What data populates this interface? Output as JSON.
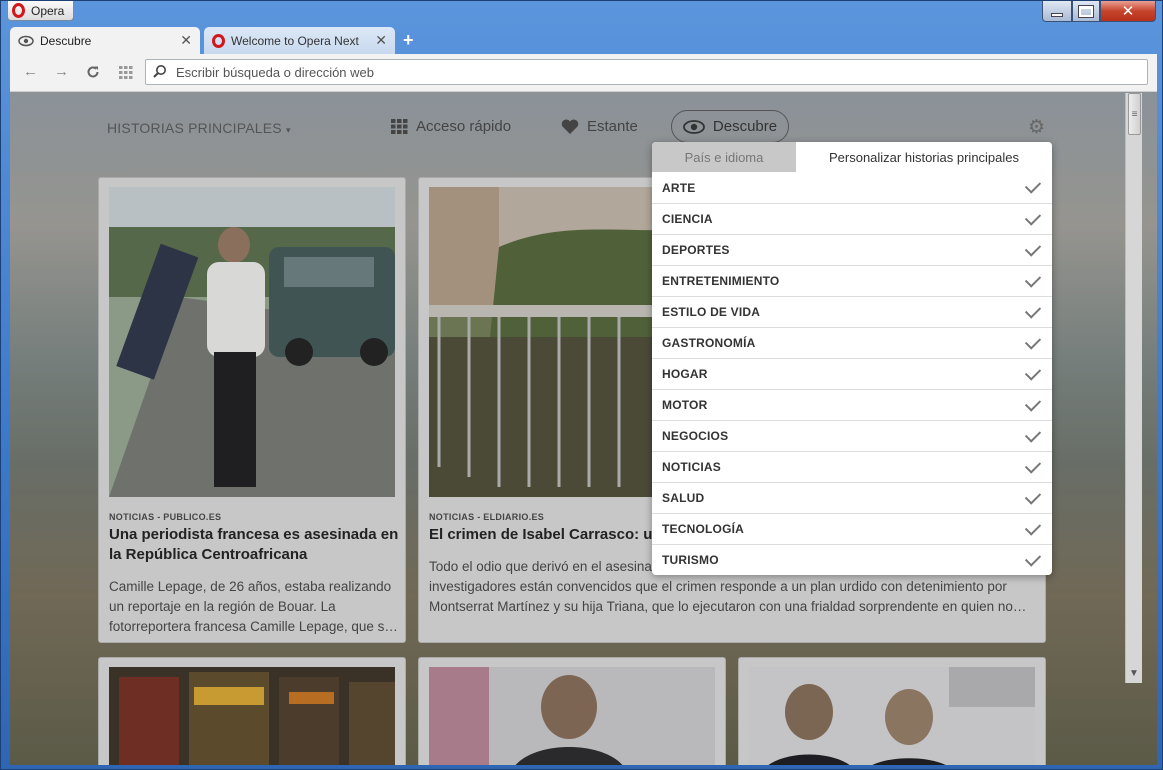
{
  "window": {
    "app_name": "Opera"
  },
  "tabs": [
    {
      "label": "Descubre",
      "active": true,
      "icon": "eye-icon"
    },
    {
      "label": "Welcome to Opera Next",
      "active": false,
      "icon": "opera-icon"
    }
  ],
  "address_bar": {
    "placeholder": "Escribir búsqueda o dirección web"
  },
  "topnav": {
    "historias": "HISTORIAS PRINCIPALES",
    "acceso": "Acceso rápido",
    "estante": "Estante",
    "descubre": "Descubre"
  },
  "cards": [
    {
      "meta": "NOTICIAS - PUBLICO.ES",
      "title_lines": [
        "Una periodista francesa es asesinada en",
        "la República Centroafricana"
      ],
      "body_lines": [
        "Camille Lepage, de 26 años, estaba realizando",
        "un reportaje en la región de Bouar. La",
        "fotorreportera francesa Camille Lepage, que s…"
      ]
    },
    {
      "meta": "NOTICIAS - ELDIARIO.ES",
      "title_lines": [
        "El crimen de Isabel Carrasco: un"
      ],
      "body_lines": [
        "Todo el odio que derivó en el asesina",
        "investigadores están convencidos que el crimen responde a un plan urdido con detenimiento por",
        "Montserrat Martínez y su hija Triana, que lo ejecutaron con una frialdad sorprendente en quien no…"
      ]
    }
  ],
  "panel": {
    "tab_off": "País e idioma",
    "tab_on": "Personalizar historias principales",
    "categories": [
      "ARTE",
      "CIENCIA",
      "DEPORTES",
      "ENTRETENIMIENTO",
      "ESTILO DE VIDA",
      "GASTRONOMÍA",
      "HOGAR",
      "MOTOR",
      "NEGOCIOS",
      "NOTICIAS",
      "SALUD",
      "TECNOLOGÍA",
      "TURISMO"
    ]
  },
  "colors": {
    "titlebar": "#3a78c8",
    "close": "#c7442c",
    "opera_red": "#d4161b"
  }
}
